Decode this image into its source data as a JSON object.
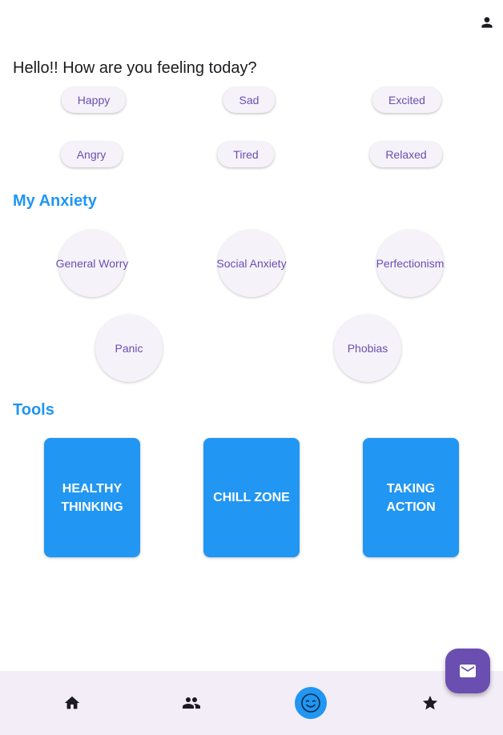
{
  "header": {
    "profile_icon": "person-icon"
  },
  "greeting": "Hello!! How are you feeling today?",
  "moods": [
    "Happy",
    "Sad",
    "Excited",
    "Angry",
    "Tired",
    "Relaxed"
  ],
  "anxiety": {
    "title": "My Anxiety",
    "items": [
      "General Worry",
      "Social Anxiety",
      "Perfectionism",
      "Panic",
      "Phobias"
    ]
  },
  "tools": {
    "title": "Tools",
    "items": [
      "HEALTHY\nTHINKING",
      "CHILL ZONE",
      "TAKING\nACTION"
    ]
  },
  "fab": {
    "icon": "mail-icon"
  },
  "bottom_nav": {
    "items": [
      "home-icon",
      "people-icon",
      "smiley-icon",
      "star-icon"
    ],
    "active": "smiley-icon"
  },
  "colors": {
    "accent": "#2196f3",
    "chip_text": "#6a4fb0",
    "chip_bg": "#f6f2fa",
    "nav_bg": "#f3edf7",
    "fab_bg": "#6a4fb0"
  }
}
